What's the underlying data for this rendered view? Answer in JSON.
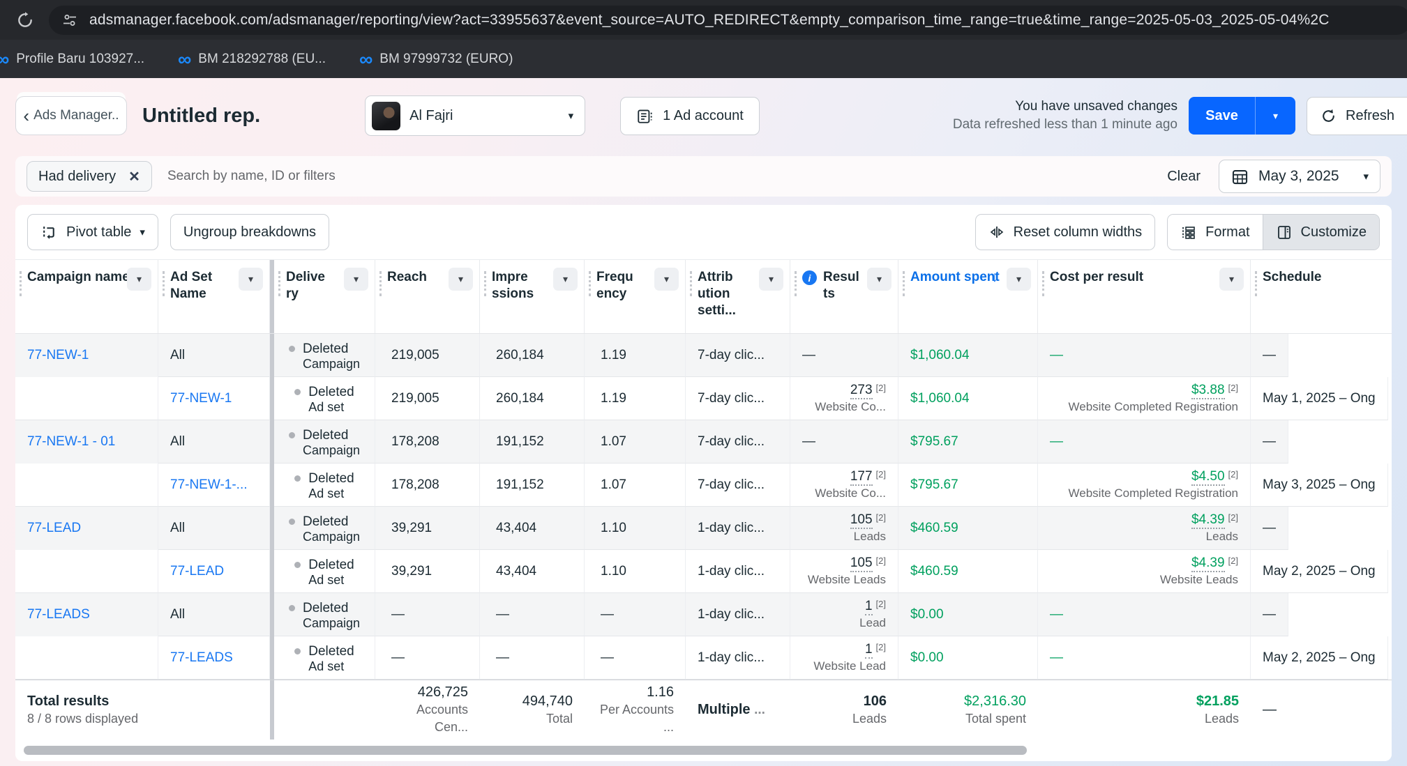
{
  "browser": {
    "url": "adsmanager.facebook.com/adsmanager/reporting/view?act=33955637&event_source=AUTO_REDIRECT&empty_comparison_time_range=true&time_range=2025-05-03_2025-05-04%2C",
    "bookmarks": [
      {
        "label": "Profile Baru 103927..."
      },
      {
        "label": "BM 218292788 (EU..."
      },
      {
        "label": "BM 97999732 (EURO)"
      }
    ]
  },
  "header": {
    "back_button": "Ads Manager..",
    "title": "Untitled rep.",
    "account_name": "Al Fajri",
    "ad_account_button": "1 Ad account",
    "unsaved_line1": "You have unsaved changes",
    "unsaved_line2": "Data refreshed less than 1 minute ago",
    "save_label": "Save",
    "refresh_label": "Refresh"
  },
  "filter_bar": {
    "chip": "Had delivery",
    "search_placeholder": "Search by name, ID or filters",
    "clear_label": "Clear",
    "date_label": "May 3, 2025"
  },
  "toolbar": {
    "pivot_label": "Pivot table",
    "ungroup_label": "Ungroup breakdowns",
    "reset_label": "Reset column widths",
    "format_label": "Format",
    "customize_label": "Customize"
  },
  "table": {
    "headers": {
      "campaign": "Campaign name",
      "adset": "Ad Set Name",
      "delivery": "Delivery",
      "reach": "Reach",
      "impressions": "Impressions",
      "frequency": "Frequency",
      "attribution": "Attribution setti...",
      "results": "Results",
      "spent": "Amount spent",
      "cost": "Cost per result",
      "schedule": "Schedule"
    },
    "rows": [
      {
        "type": "campaign",
        "campaign": "77-NEW-1",
        "adset": "All",
        "d1": "Deleted",
        "d2": "Campaign",
        "reach": "219,005",
        "impressions": "260,184",
        "frequency": "1.19",
        "attribution": "7-day clic...",
        "results": {
          "value": "—"
        },
        "spent": "$1,060.04",
        "cost": {
          "value": "—"
        },
        "schedule": "—"
      },
      {
        "type": "adset",
        "campaign": "",
        "adset": "77-NEW-1",
        "d1": "Deleted",
        "d2": "Ad set",
        "reach": "219,005",
        "impressions": "260,184",
        "frequency": "1.19",
        "attribution": "7-day clic...",
        "results": {
          "value": "273",
          "sup": "[2]",
          "label": "Website Co..."
        },
        "spent": "$1,060.04",
        "cost": {
          "value": "$3.88",
          "sup": "[2]",
          "label": "Website Completed Registration"
        },
        "schedule": "May 1, 2025 – Ong"
      },
      {
        "type": "campaign",
        "campaign": "77-NEW-1 - 01",
        "adset": "All",
        "d1": "Deleted",
        "d2": "Campaign",
        "reach": "178,208",
        "impressions": "191,152",
        "frequency": "1.07",
        "attribution": "7-day clic...",
        "results": {
          "value": "—"
        },
        "spent": "$795.67",
        "cost": {
          "value": "—"
        },
        "schedule": "—"
      },
      {
        "type": "adset",
        "campaign": "",
        "adset": "77-NEW-1-...",
        "d1": "Deleted",
        "d2": "Ad set",
        "reach": "178,208",
        "impressions": "191,152",
        "frequency": "1.07",
        "attribution": "7-day clic...",
        "results": {
          "value": "177",
          "sup": "[2]",
          "label": "Website Co..."
        },
        "spent": "$795.67",
        "cost": {
          "value": "$4.50",
          "sup": "[2]",
          "label": "Website Completed Registration"
        },
        "schedule": "May 3, 2025 – Ong"
      },
      {
        "type": "campaign",
        "campaign": "77-LEAD",
        "adset": "All",
        "d1": "Deleted",
        "d2": "Campaign",
        "reach": "39,291",
        "impressions": "43,404",
        "frequency": "1.10",
        "attribution": "1-day clic...",
        "results": {
          "value": "105",
          "sup": "[2]",
          "label": "Leads"
        },
        "spent": "$460.59",
        "cost": {
          "value": "$4.39",
          "sup": "[2]",
          "label": "Leads"
        },
        "schedule": "—"
      },
      {
        "type": "adset",
        "campaign": "",
        "adset": "77-LEAD",
        "d1": "Deleted",
        "d2": "Ad set",
        "reach": "39,291",
        "impressions": "43,404",
        "frequency": "1.10",
        "attribution": "1-day clic...",
        "results": {
          "value": "105",
          "sup": "[2]",
          "label": "Website Leads"
        },
        "spent": "$460.59",
        "cost": {
          "value": "$4.39",
          "sup": "[2]",
          "label": "Website Leads"
        },
        "schedule": "May 2, 2025 – Ong"
      },
      {
        "type": "campaign",
        "campaign": "77-LEADS",
        "adset": "All",
        "d1": "Deleted",
        "d2": "Campaign",
        "reach": "—",
        "impressions": "—",
        "frequency": "—",
        "attribution": "1-day clic...",
        "results": {
          "value": "1",
          "sup": "[2]",
          "label": "Lead"
        },
        "spent": "$0.00",
        "cost": {
          "value": "—"
        },
        "schedule": "—"
      },
      {
        "type": "adset",
        "campaign": "",
        "adset": "77-LEADS",
        "d1": "Deleted",
        "d2": "Ad set",
        "reach": "—",
        "impressions": "—",
        "frequency": "—",
        "attribution": "1-day clic...",
        "results": {
          "value": "1",
          "sup": "[2]",
          "label": "Website Lead"
        },
        "spent": "$0.00",
        "cost": {
          "value": "—"
        },
        "schedule": "May 2, 2025 – Ong"
      }
    ],
    "totals": {
      "label": "Total results",
      "sublabel": "8 / 8 rows displayed",
      "reach": "426,725",
      "reach_sub": "Accounts Cen...",
      "impressions": "494,740",
      "impressions_sub": "Total",
      "frequency": "1.16",
      "frequency_sub": "Per Accounts ...",
      "attribution": "Multiple",
      "attribution_more": "...",
      "results": "106",
      "results_sub": "Leads",
      "spent": "$2,316.30",
      "spent_sub": "Total spent",
      "cost": "$21.85",
      "cost_sub": "Leads",
      "schedule": "—"
    }
  },
  "colors": {
    "save_blue": "#0866ff",
    "link_blue": "#1877f2",
    "positive_green": "#00a05e",
    "header_sort_blue": "#1877f2"
  }
}
